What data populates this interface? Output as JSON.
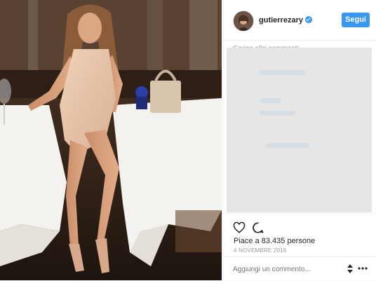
{
  "header": {
    "username": "gutierrezary",
    "follow_label": "Segui",
    "verified_icon": "verified-badge-icon"
  },
  "comments": {
    "load_more": "Carica altri commenti"
  },
  "actions": {
    "like_icon": "heart-icon",
    "comment_icon": "comment-bubble-icon",
    "likes_text": "Piace a 83.435 persone",
    "date": "4 NOVEMBRE 2016"
  },
  "comment_box": {
    "placeholder": "Aggiungi un commento...",
    "sort_icon": "sort-arrows-icon",
    "more_icon": "more-options-icon"
  },
  "colors": {
    "accent": "#3897f0",
    "text": "#262626",
    "muted": "#999999"
  }
}
